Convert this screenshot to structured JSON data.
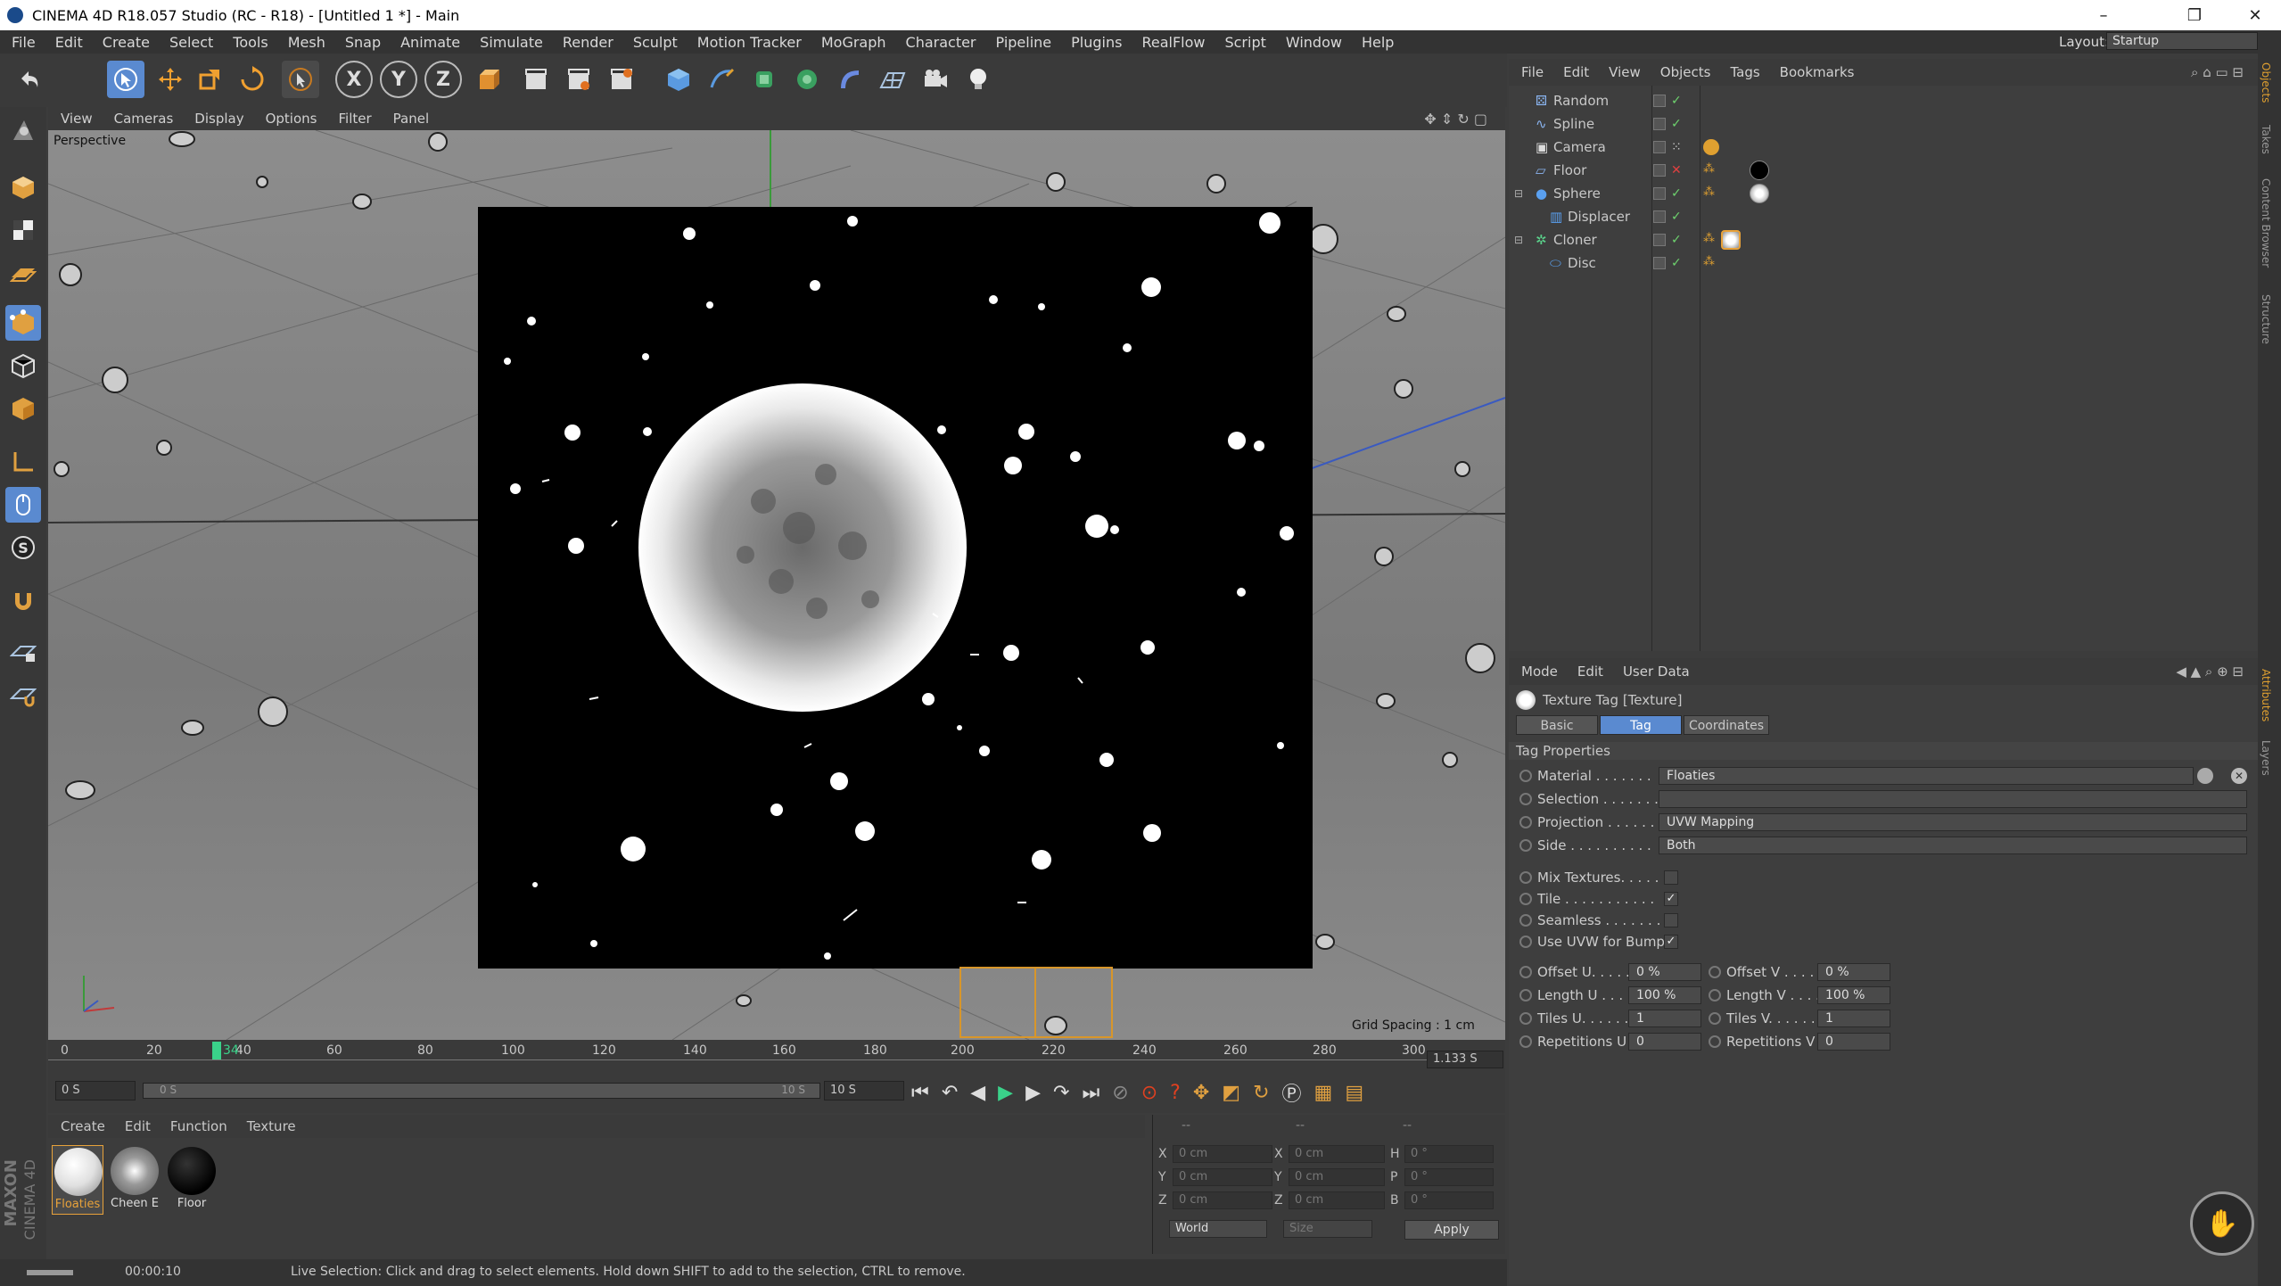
{
  "window": {
    "title": "CINEMA 4D R18.057 Studio (RC - R18) - [Untitled 1 *] - Main",
    "controls": [
      "–",
      "❐",
      "✕"
    ]
  },
  "menubar": {
    "items": [
      "File",
      "Edit",
      "Create",
      "Select",
      "Tools",
      "Mesh",
      "Snap",
      "Animate",
      "Simulate",
      "Render",
      "Sculpt",
      "Motion Tracker",
      "MoGraph",
      "Character",
      "Pipeline",
      "Plugins",
      "RealFlow",
      "Script",
      "Window",
      "Help"
    ],
    "layout_label": "Layout:",
    "layout_value": "Startup"
  },
  "toolbar": {
    "axis_x": "X",
    "axis_y": "Y",
    "axis_z": "Z"
  },
  "viewport": {
    "menu": [
      "View",
      "Cameras",
      "Display",
      "Options",
      "Filter",
      "Panel"
    ],
    "camera_label": "Perspective",
    "grid_spacing": "Grid Spacing : 1 cm"
  },
  "timeline": {
    "ticks": [
      "0",
      "20",
      "40",
      "60",
      "80",
      "100",
      "120",
      "140",
      "160",
      "180",
      "200",
      "220",
      "240",
      "260",
      "280",
      "300"
    ],
    "current_frame": "34",
    "frame_readout": "1.133 S",
    "start_field": "0 S",
    "range_start": "0 S",
    "range_end": "10 S",
    "end_field": "10 S"
  },
  "materials": {
    "menu": [
      "Create",
      "Edit",
      "Function",
      "Texture"
    ],
    "items": [
      {
        "name": "Floaties",
        "selected": true
      },
      {
        "name": "Cheen E",
        "selected": false
      },
      {
        "name": "Floor",
        "selected": false
      }
    ],
    "brand_top": "MAXON",
    "brand_bottom": "CINEMA 4D"
  },
  "coordinates": {
    "header": [
      "--",
      "--",
      "--"
    ],
    "rows": [
      {
        "a": "X",
        "av": "0 cm",
        "b": "X",
        "bv": "0 cm",
        "c": "H",
        "cv": "0 °"
      },
      {
        "a": "Y",
        "av": "0 cm",
        "b": "Y",
        "bv": "0 cm",
        "c": "P",
        "cv": "0 °"
      },
      {
        "a": "Z",
        "av": "0 cm",
        "b": "Z",
        "bv": "0 cm",
        "c": "B",
        "cv": "0 °"
      }
    ],
    "space": "World",
    "size": "Size",
    "apply": "Apply"
  },
  "status": {
    "time": "00:00:10",
    "message": "Live Selection: Click and drag to select elements. Hold down SHIFT to add to the selection, CTRL to remove."
  },
  "object_manager": {
    "menu": [
      "File",
      "Edit",
      "View",
      "Objects",
      "Tags",
      "Bookmarks"
    ],
    "objects": [
      {
        "name": "Random",
        "indent": 0
      },
      {
        "name": "Spline",
        "indent": 0
      },
      {
        "name": "Camera",
        "indent": 0
      },
      {
        "name": "Floor",
        "indent": 0
      },
      {
        "name": "Sphere",
        "indent": 0
      },
      {
        "name": "Displacer",
        "indent": 1
      },
      {
        "name": "Cloner",
        "indent": 0
      },
      {
        "name": "Disc",
        "indent": 1
      }
    ]
  },
  "attributes": {
    "menu": [
      "Mode",
      "Edit",
      "User Data"
    ],
    "title": "Texture Tag [Texture]",
    "tabs": [
      "Basic",
      "Tag",
      "Coordinates"
    ],
    "active_tab": "Tag",
    "section": "Tag Properties",
    "material_label": "Material . . . . . . .",
    "material_value": "Floaties",
    "selection_label": "Selection . . . . . . .",
    "selection_value": "",
    "projection_label": "Projection . . . . . .",
    "projection_value": "UVW Mapping",
    "side_label": "Side . . . . . . . . . .",
    "side_value": "Both",
    "mix_label": "Mix Textures. . . . .",
    "tile_label": "Tile . . . . . . . . . . .",
    "seamless_label": "Seamless . . . . . . .",
    "useuvw_label": "Use UVW for Bump",
    "offset_u_label": "Offset U. . . . .",
    "offset_u": "0 %",
    "offset_v_label": "Offset V . . . .",
    "offset_v": "0 %",
    "length_u_label": "Length U . . . .",
    "length_u": "100 %",
    "length_v_label": "Length V . . . .",
    "length_v": "100 %",
    "tiles_u_label": "Tiles U. . . . . .",
    "tiles_u": "1",
    "tiles_v_label": "Tiles V. . . . . .",
    "tiles_v": "1",
    "rep_u_label": "Repetitions U",
    "rep_u": "0",
    "rep_v_label": "Repetitions V",
    "rep_v": "0"
  },
  "side_tabs": [
    "Objects",
    "Takes",
    "Content Browser",
    "Structure"
  ],
  "side_tabs_lower": [
    "Attributes",
    "Layers"
  ],
  "colors": {
    "accent": "#5a8ad0",
    "selection": "#e8a23a",
    "check": "#6ed36e"
  }
}
